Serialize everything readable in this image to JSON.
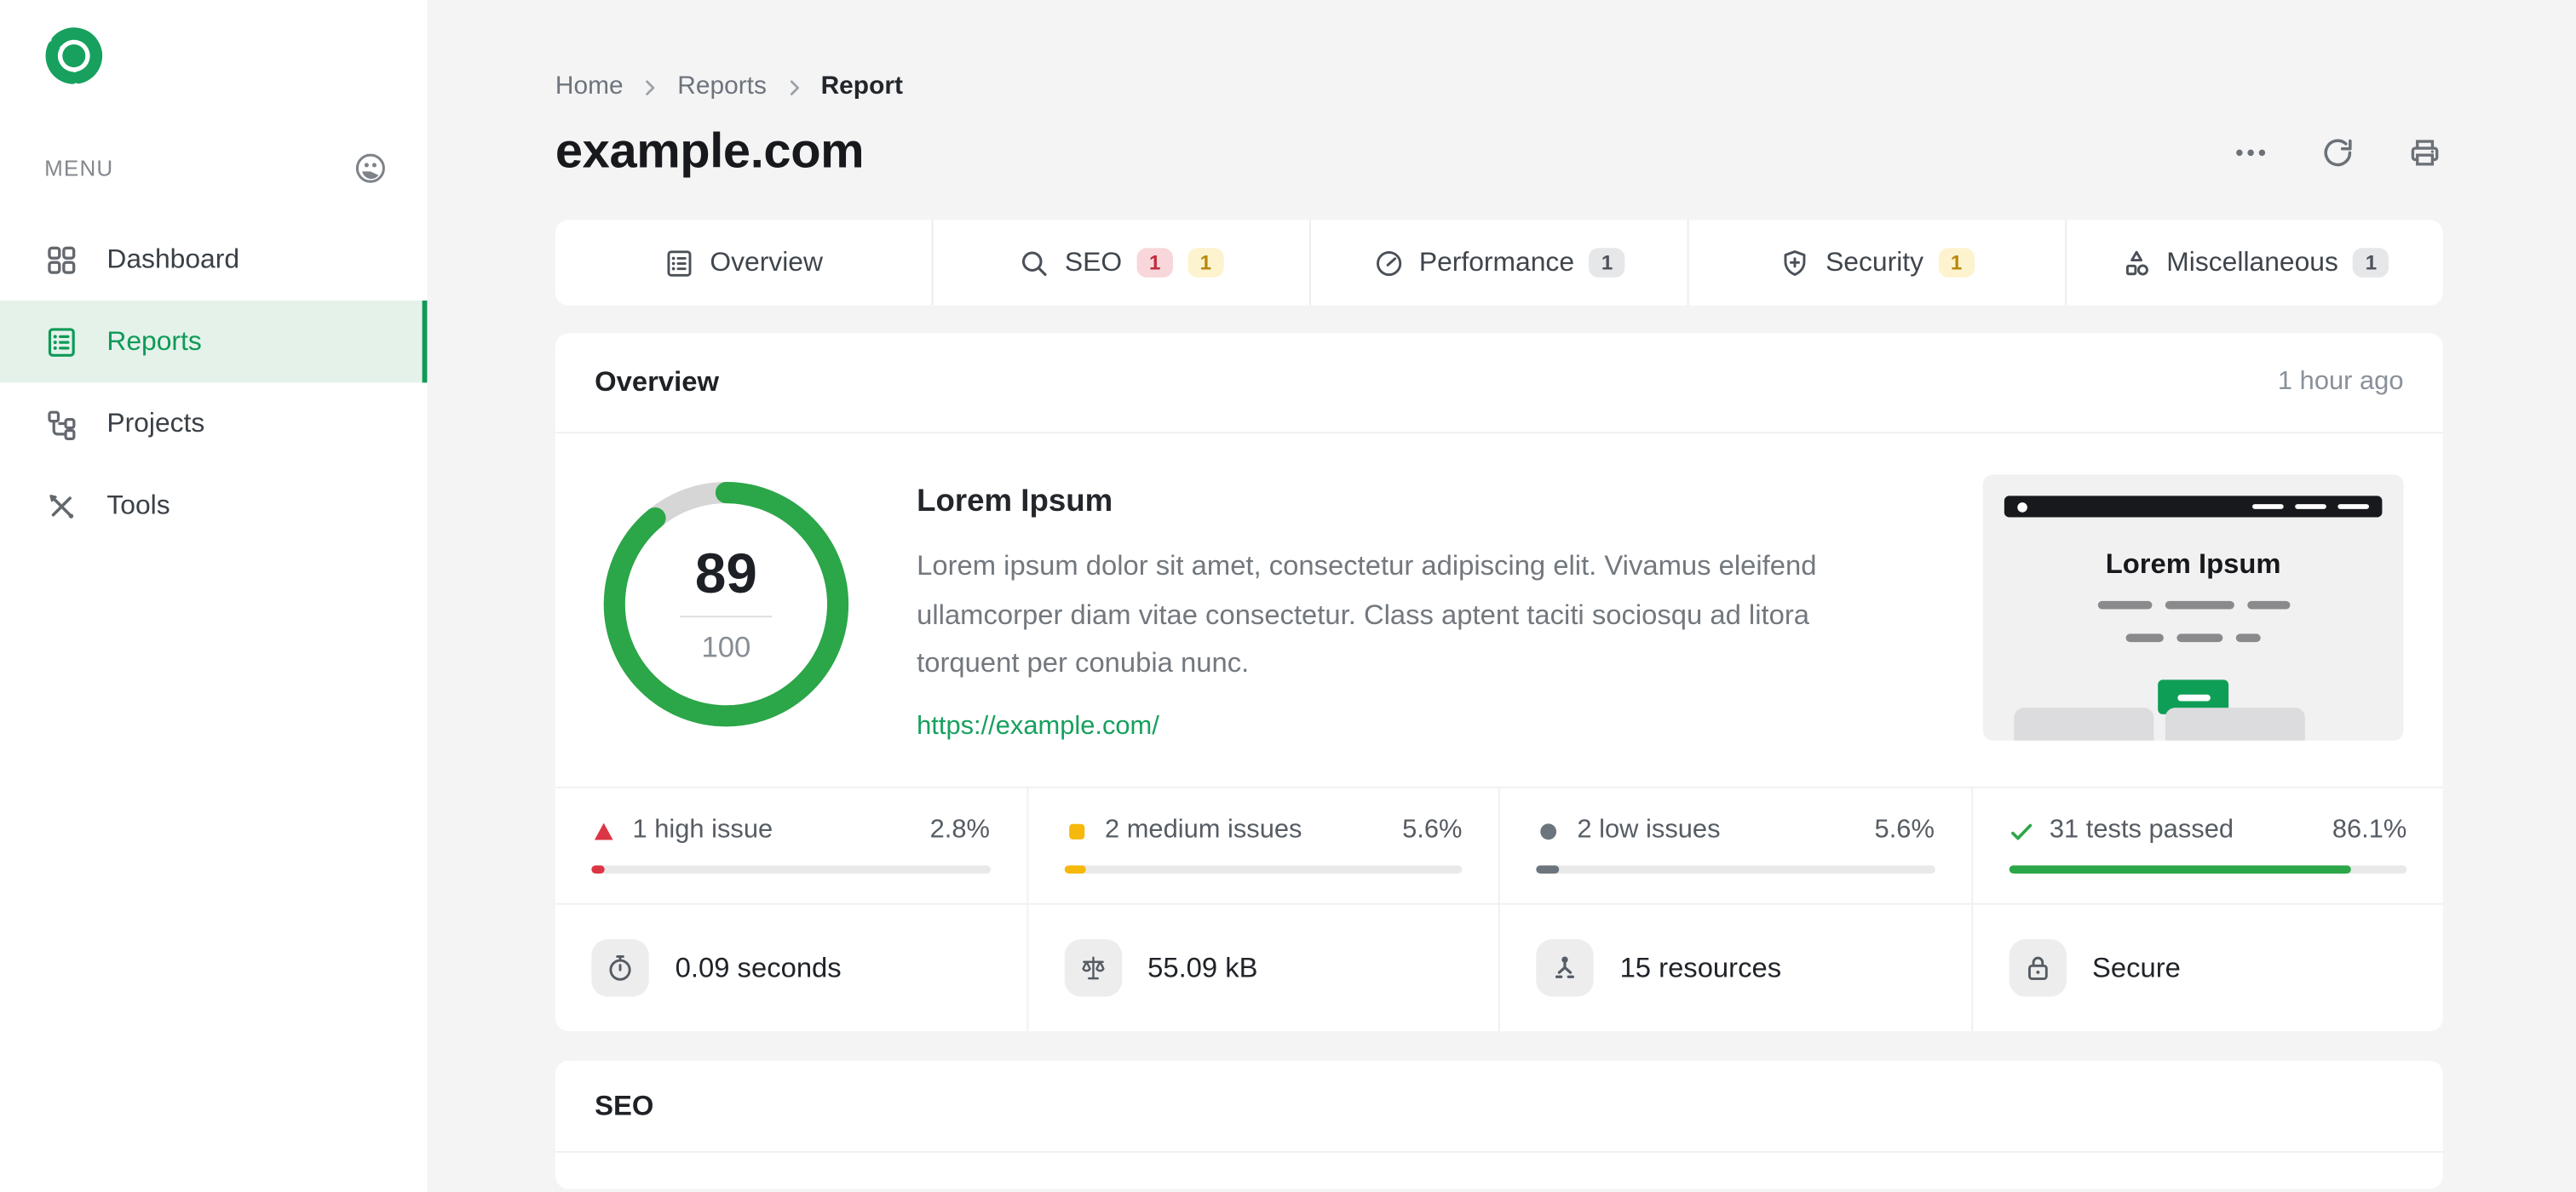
{
  "colors": {
    "accent": "#0f9a58",
    "success": "#2ba648",
    "danger": "#dc3545",
    "warning": "#f6b80b",
    "muted": "#6c757d"
  },
  "sidebar": {
    "menu_label": "MENU",
    "items": [
      {
        "label": "Dashboard",
        "active": false
      },
      {
        "label": "Reports",
        "active": true
      },
      {
        "label": "Projects",
        "active": false
      },
      {
        "label": "Tools",
        "active": false
      }
    ]
  },
  "breadcrumb": {
    "items": [
      "Home",
      "Reports",
      "Report"
    ]
  },
  "page": {
    "title": "example.com"
  },
  "header_actions": [
    {
      "icon": "ellipsis-icon"
    },
    {
      "icon": "refresh-icon"
    },
    {
      "icon": "printer-icon"
    }
  ],
  "tabs": [
    {
      "label": "Overview",
      "badges": []
    },
    {
      "label": "SEO",
      "badges": [
        {
          "text": "1",
          "type": "red"
        },
        {
          "text": "1",
          "type": "yellow"
        }
      ]
    },
    {
      "label": "Performance",
      "badges": [
        {
          "text": "1",
          "type": "gray"
        }
      ]
    },
    {
      "label": "Security",
      "badges": [
        {
          "text": "1",
          "type": "yellow"
        }
      ]
    },
    {
      "label": "Miscellaneous",
      "badges": [
        {
          "text": "1",
          "type": "gray"
        }
      ]
    }
  ],
  "overview": {
    "section_title": "Overview",
    "timestamp": "1 hour ago",
    "score": {
      "value": "89",
      "max": "100",
      "percent": 89
    },
    "site": {
      "heading": "Lorem Ipsum",
      "description": "Lorem ipsum dolor sit amet, consectetur adipiscing elit. Vivamus eleifend ullamcorper diam vitae consectetur. Class aptent taciti sociosqu ad litora torquent per conubia nunc.",
      "url": "https://example.com/"
    },
    "thumbnail": {
      "title": "Lorem Ipsum"
    },
    "issue_stats": [
      {
        "label": "1 high issue",
        "percent": "2.8%",
        "value": 2.8,
        "severity": "high",
        "color": "#dc3545"
      },
      {
        "label": "2 medium issues",
        "percent": "5.6%",
        "value": 5.6,
        "severity": "medium",
        "color": "#f6b80b"
      },
      {
        "label": "2 low issues",
        "percent": "5.6%",
        "value": 5.6,
        "severity": "low",
        "color": "#6c757d"
      },
      {
        "label": "31 tests passed",
        "percent": "86.1%",
        "value": 86.1,
        "severity": "passed",
        "color": "#2ba648"
      }
    ],
    "quick_stats": [
      {
        "label": "0.09 seconds",
        "icon": "stopwatch-icon"
      },
      {
        "label": "55.09 kB",
        "icon": "scale-icon"
      },
      {
        "label": "15 resources",
        "icon": "resources-icon"
      },
      {
        "label": "Secure",
        "icon": "lock-icon"
      }
    ]
  },
  "seo_section": {
    "title": "SEO"
  }
}
